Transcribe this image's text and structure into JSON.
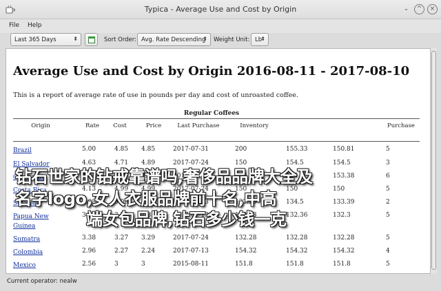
{
  "window": {
    "title": "Typica - Average Use and Cost by Origin",
    "minimize_glyph": "⌄",
    "maximize_glyph": "^",
    "close_glyph": "×"
  },
  "menu": {
    "file": "File",
    "help": "Help"
  },
  "toolbar": {
    "date_range": "Last 365 Days",
    "sort_label": "Sort Order:",
    "sort_value": "Avg. Rate Descending",
    "unit_label": "Weight Unit:",
    "unit_value": "Lb",
    "arrow_glyph": "⬍"
  },
  "report": {
    "title": "Average Use and Cost by Origin 2016-08-11 - 2017-08-10",
    "subtitle": "This is a report of average rate of use in pounds per day and cost of unroasted coffee.",
    "group_header": "Regular Coffees",
    "columns": [
      "Origin",
      "Rate",
      "Cost",
      "Price",
      "Last Purchase",
      "Inventory",
      "",
      "",
      "Purchase"
    ],
    "rows": [
      {
        "origin": "Brazil",
        "rate": "5.00",
        "avg_cost": "4.85",
        "price": "4.85",
        "date": "2017-07-31",
        "v1": "200",
        "v2": "155.33",
        "v3": "150.81",
        "n": "5"
      },
      {
        "origin": "El Salvador",
        "rate": "4.63",
        "avg_cost": "4.71",
        "price": "4.89",
        "date": "2017-07-24",
        "v1": "150",
        "v2": "154.5",
        "v3": "154.5",
        "n": "3"
      },
      {
        "origin": "Guatemala",
        "rate": "4.14",
        "avg_cost": "3.78",
        "price": "3.41",
        "date": "2017-07-31",
        "v1": "150",
        "v2": "150",
        "v3": "153.38",
        "n": "6"
      },
      {
        "origin": "Costa Rica",
        "rate": "4.13",
        "avg_cost": "4.99",
        "price": "4.99",
        "date": "2017-07-24",
        "v1": "150",
        "v2": "150",
        "v3": "150",
        "n": "5"
      },
      {
        "origin": "Sulawesi",
        "rate": "4.08",
        "avg_cost": "3.08",
        "price": "2.97",
        "date": "2017-07-13",
        "v1": "132.28",
        "v2": "134.5",
        "v3": "133.39",
        "n": "2"
      },
      {
        "origin": "Papua New Guinea",
        "rate": "3.99",
        "avg_cost": "3.36",
        "price": "2.81",
        "date": "2017-07-13",
        "v1": "132.28",
        "v2": "132.36",
        "v3": "132.3",
        "n": "5"
      },
      {
        "origin": "Sumatra",
        "rate": "3.38",
        "avg_cost": "3.27",
        "price": "3.29",
        "date": "2017-07-24",
        "v1": "132.28",
        "v2": "132.28",
        "v3": "132.28",
        "n": "5"
      },
      {
        "origin": "Colombia",
        "rate": "2.96",
        "avg_cost": "2.27",
        "price": "2.24",
        "date": "2017-07-13",
        "v1": "154.32",
        "v2": "154.32",
        "v3": "154.32",
        "n": "4"
      },
      {
        "origin": "Mexico",
        "rate": "2.56",
        "avg_cost": "3",
        "price": "3",
        "date": "2015-08-11",
        "v1": "151.8",
        "v2": "151.8",
        "v3": "151.8",
        "n": "5"
      }
    ]
  },
  "overlay": {
    "line1": "钻石世家的钻戒靠谱吗,奢侈品品牌大全及",
    "line2": "名字logo,女人衣服品牌前十名,中高",
    "line3": "端女包品牌,钻石多少钱一克"
  },
  "status": {
    "text": "Current operator: nealw"
  }
}
